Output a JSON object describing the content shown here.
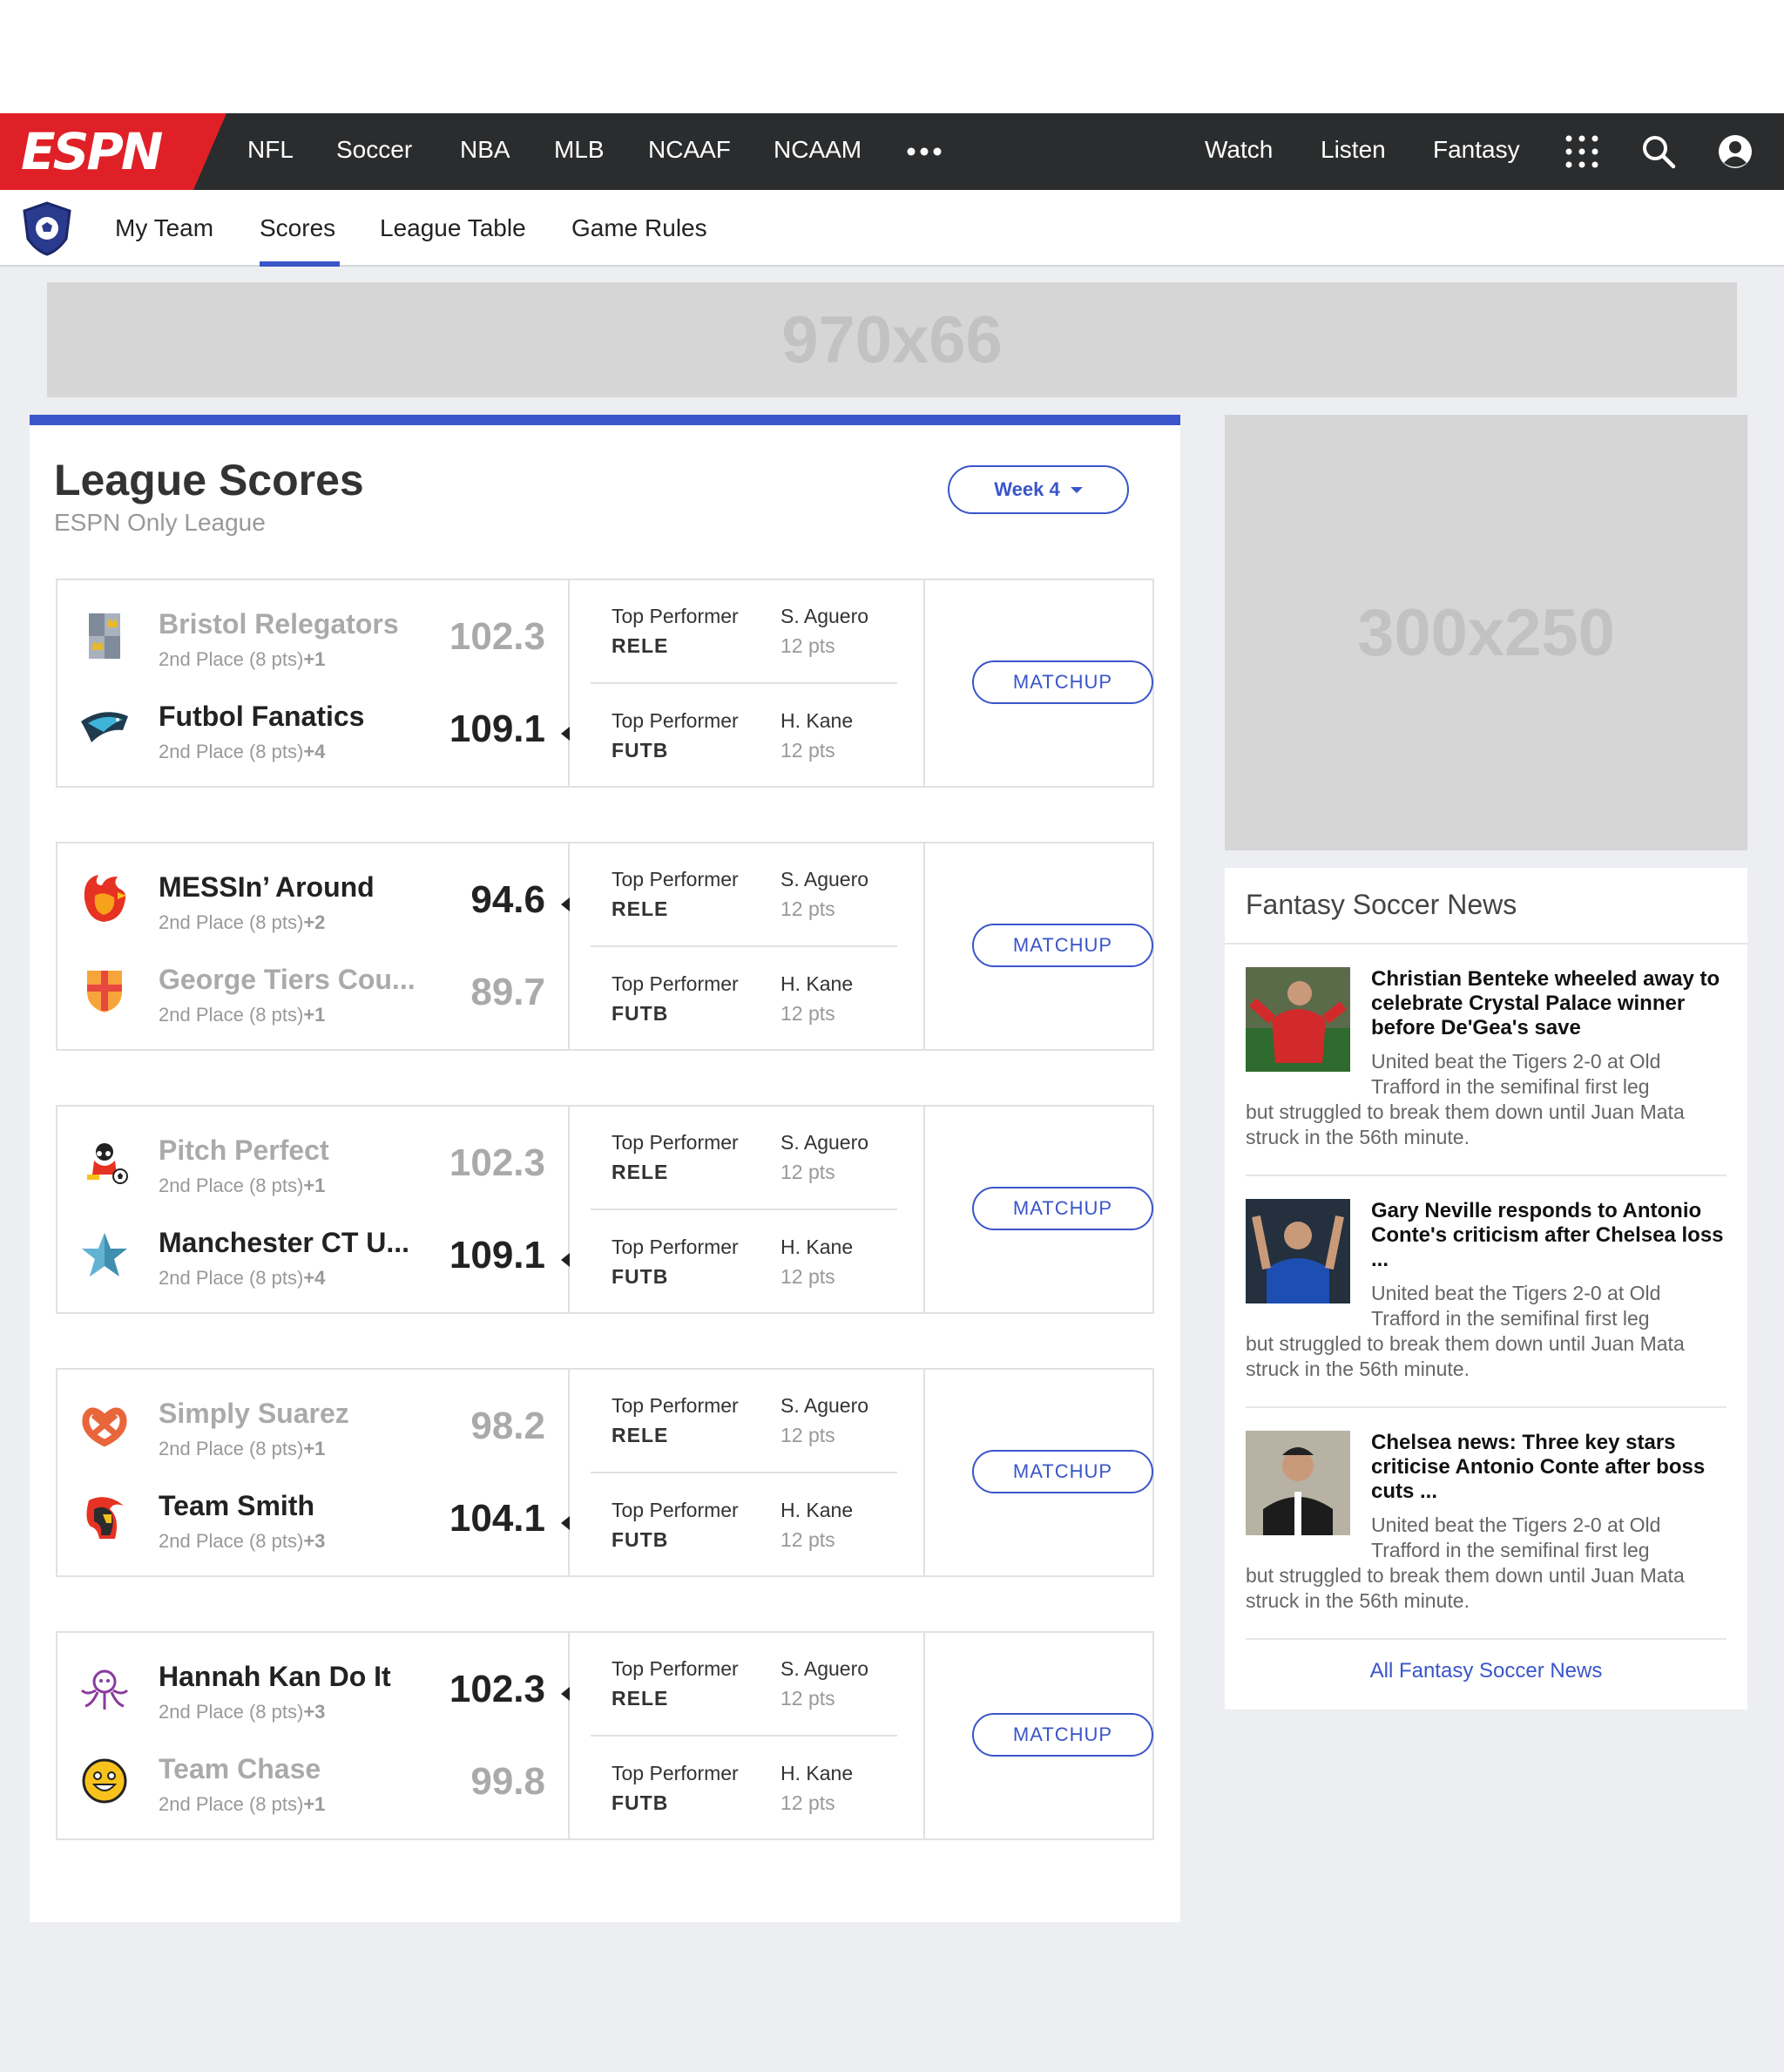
{
  "nav": {
    "logo": "ESPN",
    "items": [
      "NFL",
      "Soccer",
      "NBA",
      "MLB",
      "NCAAF",
      "NCAAM"
    ],
    "right_items": [
      "Watch",
      "Listen",
      "Fantasy"
    ]
  },
  "subnav": {
    "items": [
      "My Team",
      "Scores",
      "League Table",
      "Game Rules"
    ],
    "active": "Scores"
  },
  "ads": {
    "banner": "970x66",
    "box": "300x250"
  },
  "league": {
    "title": "League Scores",
    "subtitle": "ESPN Only League",
    "week_label": "Week 4",
    "matchup_label": "MATCHUP",
    "top_performer_label": "Top Performer"
  },
  "matchups": [
    {
      "home": {
        "name": "Bristol Relegators",
        "place": "2nd Place (8 pts)",
        "change": "+1",
        "score": "102.3",
        "result": "lose"
      },
      "away": {
        "name": "Futbol Fanatics",
        "place": "2nd Place (8 pts)",
        "change": "+4",
        "score": "109.1",
        "result": "win"
      },
      "performers": [
        {
          "abbr": "RELE",
          "player": "S. Aguero",
          "pts": "12 pts"
        },
        {
          "abbr": "FUTB",
          "player": "H. Kane",
          "pts": "12 pts"
        }
      ]
    },
    {
      "home": {
        "name": "MESSIn’ Around",
        "place": "2nd Place (8 pts)",
        "change": "+2",
        "score": "94.6",
        "result": "win"
      },
      "away": {
        "name": "George Tiers Cou...",
        "place": "2nd Place (8 pts)",
        "change": "+1",
        "score": "89.7",
        "result": "lose"
      },
      "performers": [
        {
          "abbr": "RELE",
          "player": "S. Aguero",
          "pts": "12 pts"
        },
        {
          "abbr": "FUTB",
          "player": "H. Kane",
          "pts": "12 pts"
        }
      ]
    },
    {
      "home": {
        "name": "Pitch Perfect",
        "place": "2nd Place (8 pts)",
        "change": "+1",
        "score": "102.3",
        "result": "lose"
      },
      "away": {
        "name": "Manchester CT U...",
        "place": "2nd Place (8 pts)",
        "change": "+4",
        "score": "109.1",
        "result": "win"
      },
      "performers": [
        {
          "abbr": "RELE",
          "player": "S. Aguero",
          "pts": "12 pts"
        },
        {
          "abbr": "FUTB",
          "player": "H. Kane",
          "pts": "12 pts"
        }
      ]
    },
    {
      "home": {
        "name": "Simply Suarez",
        "place": "2nd Place (8 pts)",
        "change": "+1",
        "score": "98.2",
        "result": "lose"
      },
      "away": {
        "name": "Team Smith",
        "place": "2nd Place (8 pts)",
        "change": "+3",
        "score": "104.1",
        "result": "win"
      },
      "performers": [
        {
          "abbr": "RELE",
          "player": "S. Aguero",
          "pts": "12 pts"
        },
        {
          "abbr": "FUTB",
          "player": "H. Kane",
          "pts": "12 pts"
        }
      ]
    },
    {
      "home": {
        "name": "Hannah Kan Do It",
        "place": "2nd Place (8 pts)",
        "change": "+3",
        "score": "102.3",
        "result": "win"
      },
      "away": {
        "name": "Team Chase",
        "place": "2nd Place (8 pts)",
        "change": "+1",
        "score": "99.8",
        "result": "lose"
      },
      "performers": [
        {
          "abbr": "RELE",
          "player": "S. Aguero",
          "pts": "12 pts"
        },
        {
          "abbr": "FUTB",
          "player": "H. Kane",
          "pts": "12 pts"
        }
      ]
    }
  ],
  "news": {
    "title": "Fantasy Soccer News",
    "items": [
      {
        "headline": "Christian Benteke wheeled away to celebrate Crystal Palace winner before De'Gea's save",
        "body_a": "United beat the Tigers 2-0 at Old",
        "body_b": "Trafford in the semifinal first leg",
        "body_c": "but struggled to break them down until Juan Mata struck in the 56th minute."
      },
      {
        "headline": "Gary Neville responds to Antonio Conte's criticism after Chelsea loss ...",
        "body_a": "United beat the Tigers 2-0 at Old",
        "body_b": "Trafford in the semifinal first leg",
        "body_c": "but struggled to break them down until Juan Mata struck in the 56th minute."
      },
      {
        "headline": "Chelsea news: Three key stars criticise Antonio Conte after boss cuts ...",
        "body_a": "United beat the Tigers 2-0 at Old",
        "body_b": "Trafford in the semifinal first leg",
        "body_c": "but struggled to break them down until Juan Mata struck in the 56th minute."
      }
    ],
    "all_link": "All Fantasy Soccer News"
  },
  "colors": {
    "accent": "#3a55c9",
    "brand": "#e02027",
    "nav_bg": "#2b2c2d"
  },
  "icons": [
    "search-icon",
    "account-icon",
    "apps-grid-icon",
    "more-dots-icon",
    "league-badge-icon"
  ]
}
